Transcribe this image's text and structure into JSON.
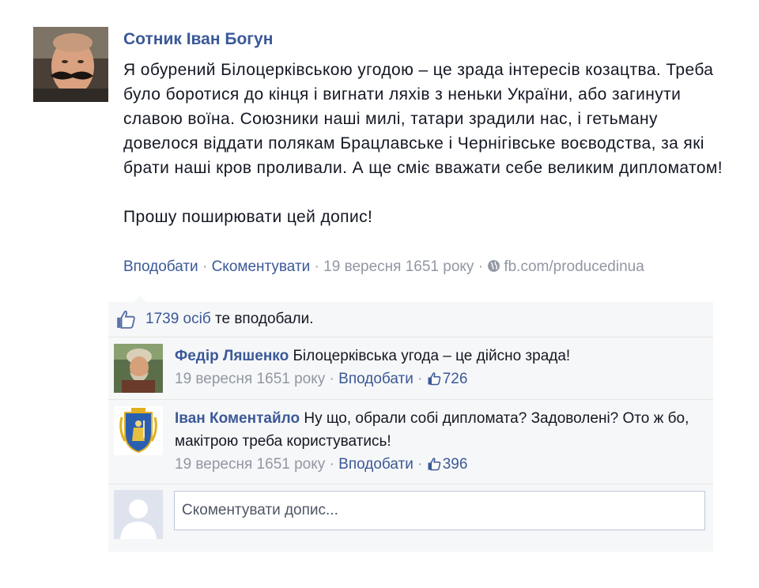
{
  "post": {
    "author": "Сотник Іван Богун",
    "body": "Я обурений Білоцерківською угодою – це зрада інтересів козацтва. Треба було боротися до кінця і вигнати ляхів з неньки України, або загинути славою воїна. Союзники наші милі, татари зрадили нас, і гетьману довелося віддати полякам Брацлавське і Чернігівське воєводства, за які брати наші кров проливали. А ще сміє вважати себе великим дипломатом!",
    "share_line": "Прошу поширювати цей допис!",
    "actions": {
      "like": "Вподобати",
      "sep1": " · ",
      "comment": "Скоментувати",
      "sep2": " · ",
      "date": "19 вересня 1651 року",
      "sep3": " · ",
      "source": "fb.com/producedinua"
    }
  },
  "likes": {
    "count": "1739 осіб",
    "suffix": " те вподобали."
  },
  "comments": [
    {
      "author": "Федір Ляшенко",
      "text": "Білоцерківська угода – це дійсно зрада!",
      "date": "19 вересня 1651 року",
      "like_label": "Вподобати",
      "like_count": "726"
    },
    {
      "author": "Іван Коментайло",
      "text": "Ну що, обрали собі дипломата? Задоволені? Ото ж бо, макітрою треба користуватись!",
      "date": "19 вересня 1651 року",
      "like_label": "Вподобати",
      "like_count": "396"
    }
  ],
  "reply": {
    "placeholder": "Скоментувати допис..."
  },
  "colors": {
    "link": "#3b5998",
    "muted": "#9197a3",
    "feedback_bg": "#f6f7f8"
  },
  "icons": [
    "author-photo",
    "thumbs-up-icon",
    "globe-icon",
    "commenter-photo",
    "coat-of-arms-avatar",
    "default-profile-icon"
  ]
}
